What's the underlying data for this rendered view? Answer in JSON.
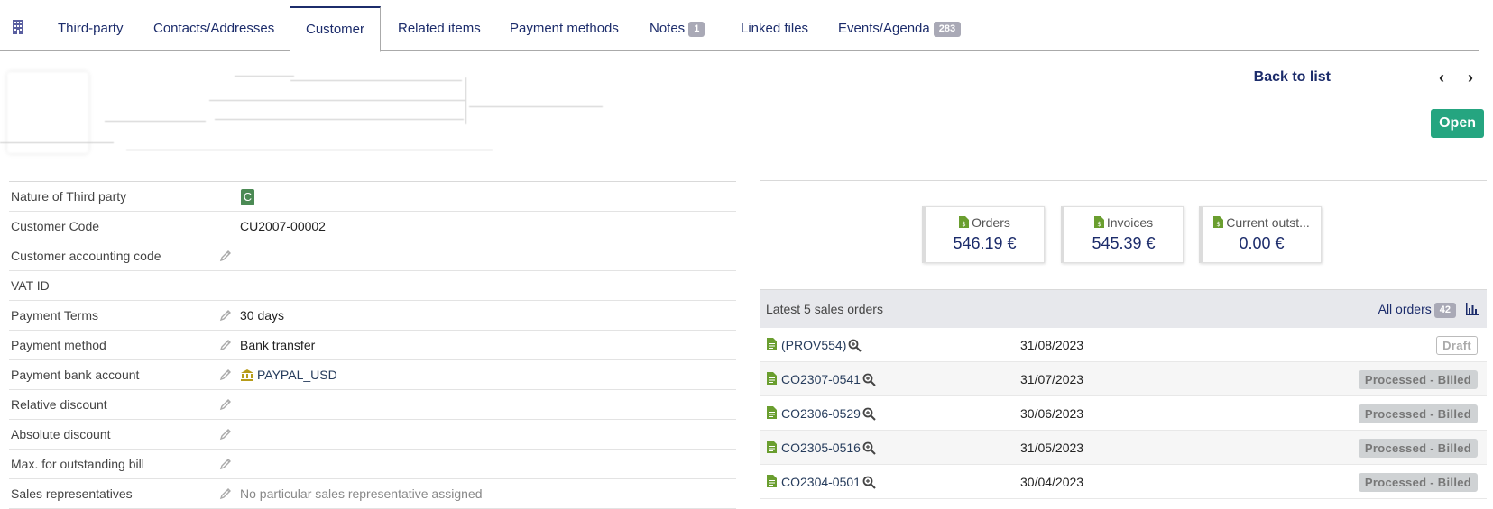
{
  "tabs": [
    {
      "label": "Third-party"
    },
    {
      "label": "Contacts/Addresses"
    },
    {
      "label": "Customer"
    },
    {
      "label": "Related items"
    },
    {
      "label": "Payment methods"
    },
    {
      "label": "Notes",
      "badge": "1"
    },
    {
      "label": "Linked files"
    },
    {
      "label": "Events/Agenda",
      "badge": "283"
    }
  ],
  "active_tab": "Customer",
  "nav": {
    "back_to_list": "Back to list"
  },
  "status": {
    "label": "Open",
    "color": "#25a580"
  },
  "info": [
    {
      "label": "Nature of Third party",
      "value": "C"
    },
    {
      "label": "Customer Code",
      "value": "CU2007-00002"
    },
    {
      "label": "Customer accounting code",
      "value": ""
    },
    {
      "label": "VAT ID",
      "value": ""
    },
    {
      "label": "Payment Terms",
      "value": "30 days"
    },
    {
      "label": "Payment method",
      "value": "Bank transfer"
    },
    {
      "label": "Payment bank account",
      "value": "PAYPAL_USD"
    },
    {
      "label": "Relative discount",
      "value": ""
    },
    {
      "label": "Absolute discount",
      "value": ""
    },
    {
      "label": "Max. for outstanding bill",
      "value": ""
    },
    {
      "label": "Sales representatives",
      "value": "No particular sales representative assigned"
    }
  ],
  "stats": [
    {
      "label": "Orders",
      "value": "546.19 €"
    },
    {
      "label": "Invoices",
      "value": "545.39 €"
    },
    {
      "label": "Current outst...",
      "value": "0.00 €"
    }
  ],
  "orders": {
    "title": "Latest 5 sales orders",
    "all_label": "All orders",
    "all_count": "42",
    "rows": [
      {
        "ref": "(PROV554)",
        "date": "31/08/2023",
        "status": "Draft"
      },
      {
        "ref": "CO2307-0541",
        "date": "31/07/2023",
        "status": "Processed - Billed"
      },
      {
        "ref": "CO2306-0529",
        "date": "30/06/2023",
        "status": "Processed - Billed"
      },
      {
        "ref": "CO2305-0516",
        "date": "31/05/2023",
        "status": "Processed - Billed"
      },
      {
        "ref": "CO2304-0501",
        "date": "30/04/2023",
        "status": "Processed - Billed"
      }
    ]
  },
  "colors": {
    "accent": "#1c2c6b",
    "doc_icon": "#6a9e2f",
    "nature_badge": "#4b8a54"
  }
}
